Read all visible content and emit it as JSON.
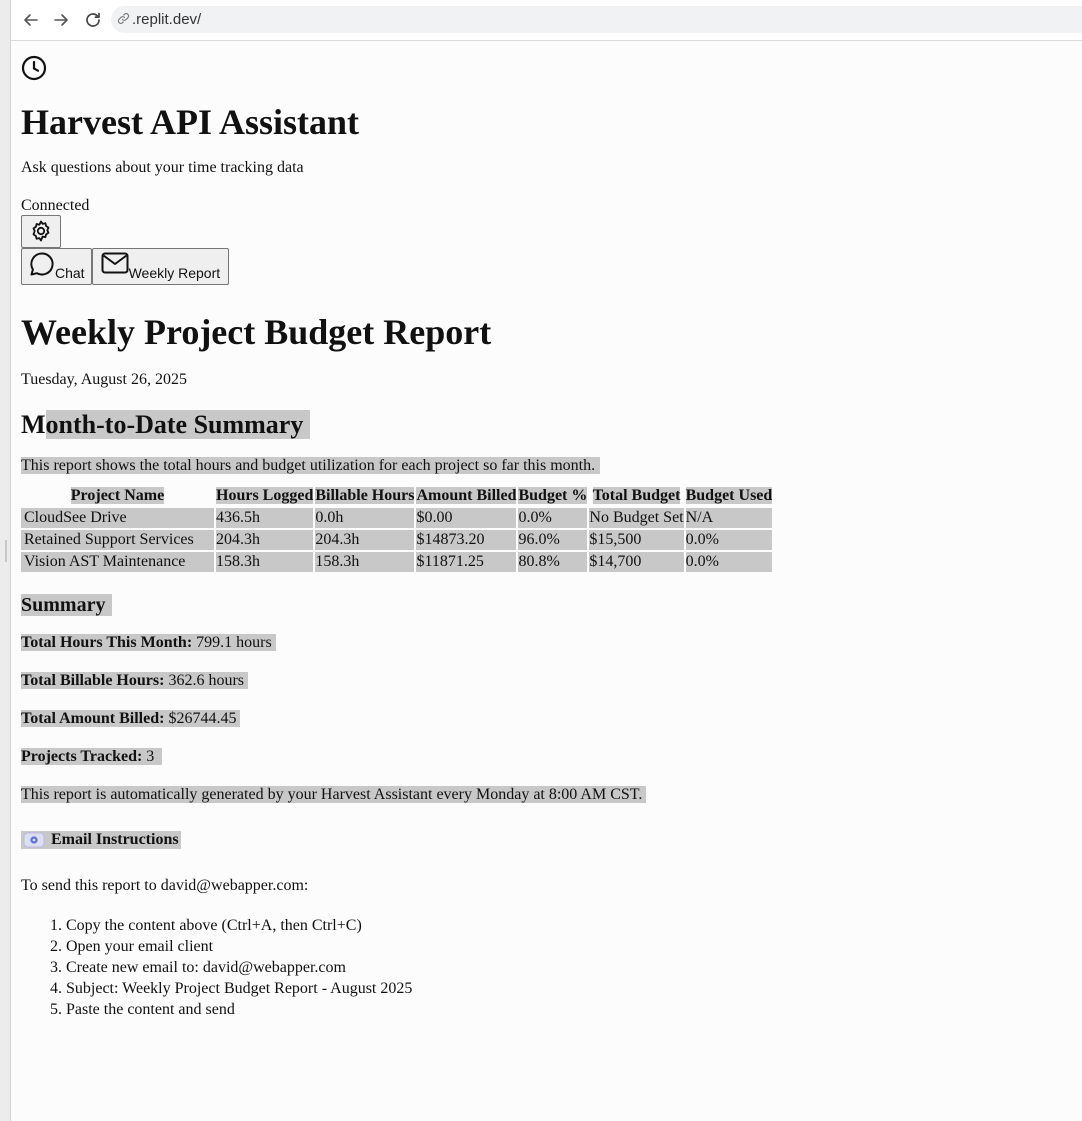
{
  "browser": {
    "url": ".replit.dev/"
  },
  "header": {
    "title": "Harvest API Assistant",
    "subtitle": "Ask questions about your time tracking data",
    "status": "Connected"
  },
  "tabs": [
    {
      "label": "Chat"
    },
    {
      "label": "Weekly Report"
    }
  ],
  "report": {
    "title": "Weekly Project Budget Report",
    "date": "Tuesday, August 26, 2025",
    "section_heading_prefix": "M",
    "section_heading_rest": "onth-to-Date Summary",
    "intro": "This report shows the total hours and budget utilization for each project so far this month.",
    "table": {
      "headers": [
        "Project Name",
        "Hours Logged",
        "Billable Hours",
        "Amount Billed",
        "Budget %",
        "Total Budget",
        "Budget Used"
      ],
      "rows": [
        [
          "CloudSee Drive",
          "436.5h",
          "0.0h",
          "$0.00",
          "0.0%",
          "No Budget Set",
          "N/A"
        ],
        [
          "Retained Support Services",
          "204.3h",
          "204.3h",
          "$14873.20",
          "96.0%",
          "$15,500",
          "0.0%"
        ],
        [
          "Vision AST Maintenance",
          "158.3h",
          "158.3h",
          "$11871.25",
          "80.8%",
          "$14,700",
          "0.0%"
        ]
      ]
    },
    "summary_heading": "Summary",
    "summary": {
      "total_hours_label": "Total Hours This Month:",
      "total_hours_value": " 799.1 hours",
      "billable_hours_label": "Total Billable Hours:",
      "billable_hours_value": " 362.6 hours",
      "amount_billed_label": "Total Amount Billed:",
      "amount_billed_value": " $26744.45",
      "projects_label": "Projects Tracked:",
      "projects_value": " 3"
    },
    "footer_note": "This report is automatically generated by your Harvest Assistant every Monday at 8:00 AM CST."
  },
  "email": {
    "heading": "Email Instructions",
    "intro": "To send this report to david@webapper.com:",
    "steps": [
      "Copy the content above (Ctrl+A, then Ctrl+C)",
      "Open your email client",
      "Create new email to: david@webapper.com",
      "Subject: Weekly Project Budget Report - August 2025",
      "Paste the content and send"
    ]
  }
}
